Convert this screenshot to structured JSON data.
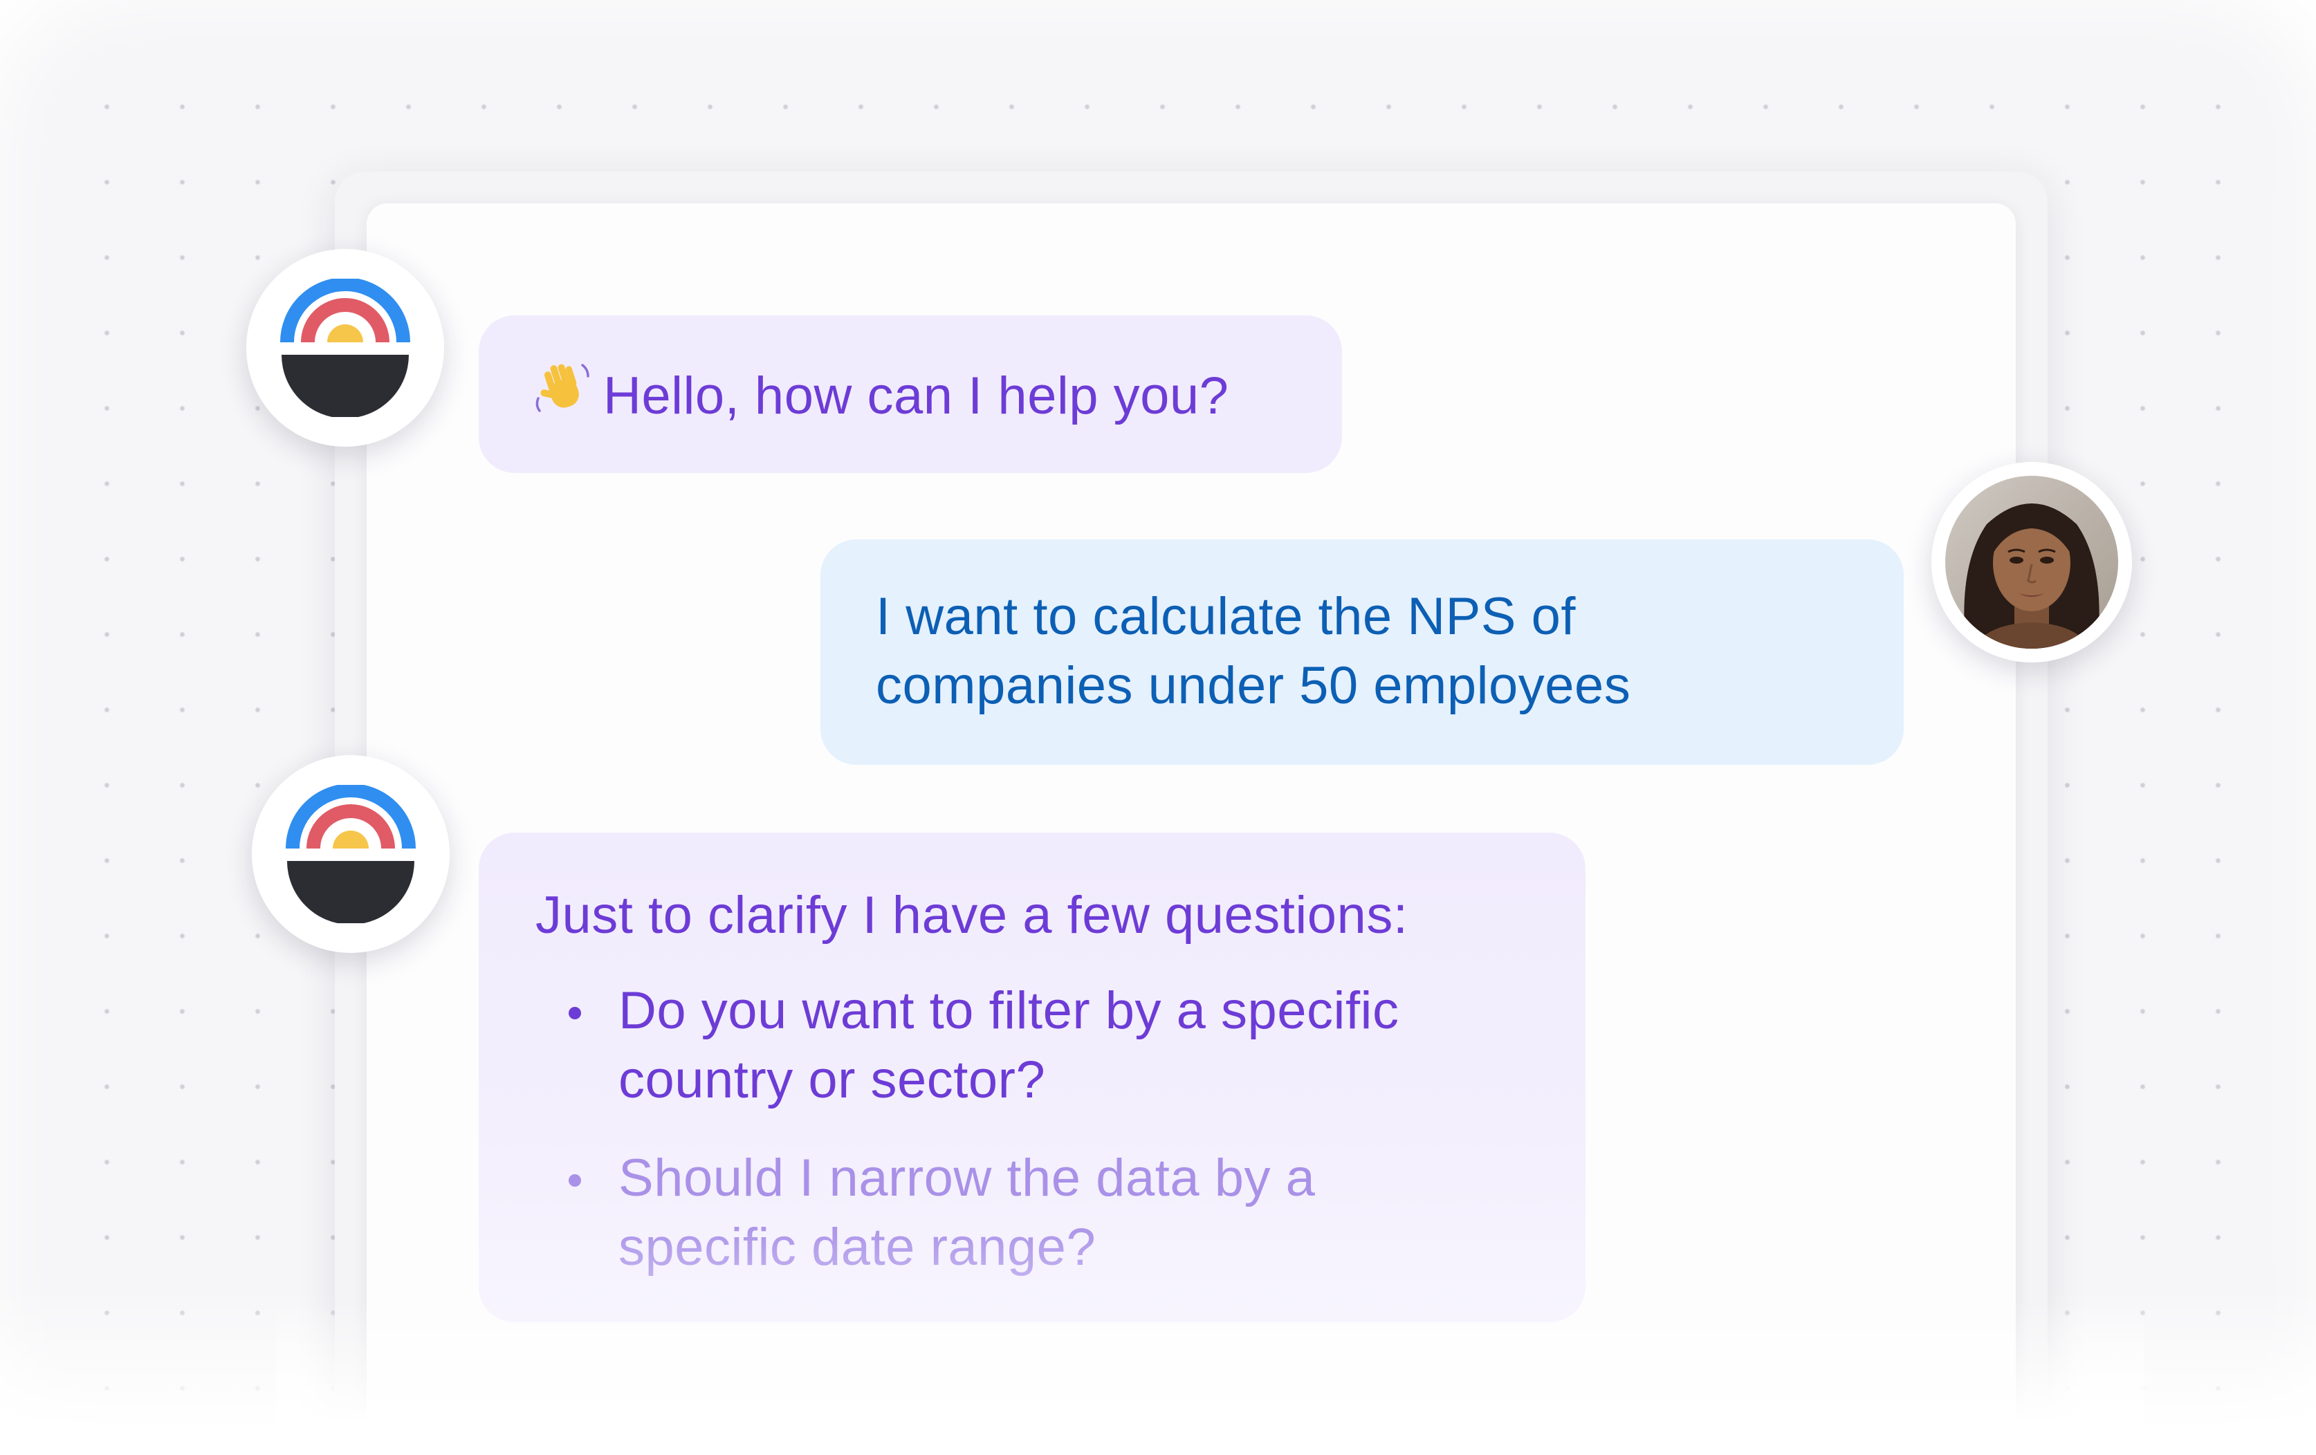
{
  "colors": {
    "bot_bubble": "#f1ecfd",
    "bot_text": "#6d3cd6",
    "user_bubble": "#e5f1fd",
    "user_text": "#0c5fb4",
    "logo_blue": "#2f8ef0",
    "logo_red": "#e05b66",
    "logo_yellow": "#f6c64a",
    "logo_dark": "#2c2d33"
  },
  "icons": {
    "bot_avatar": "rainbow-sunset-logo-icon",
    "user_avatar": "user-photo-avatar",
    "wave": "waving-hand-icon"
  },
  "chat": {
    "greeting": {
      "sender": "bot",
      "text": "Hello, how can I help you?"
    },
    "user_message": {
      "sender": "user",
      "line1": "I want to calculate the NPS of",
      "line2": "companies under 50 employees"
    },
    "clarification": {
      "sender": "bot",
      "intro": "Just to clarify I have a few questions:",
      "questions": [
        {
          "line1": "Do you want to filter by a specific",
          "line2": "country or sector?"
        },
        {
          "line1": "Should I narrow the data by a",
          "line2": "specific date range?"
        }
      ]
    }
  }
}
